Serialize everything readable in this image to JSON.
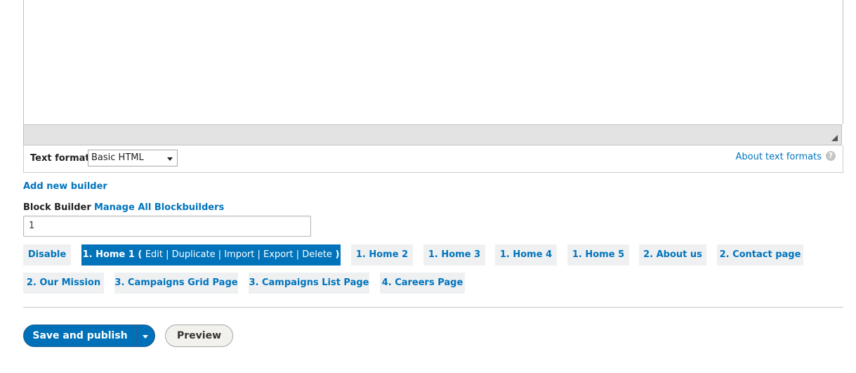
{
  "editor": {
    "text_format_label": "Text format",
    "text_format_value": "Basic HTML",
    "about_link": "About text formats",
    "help_icon": "?"
  },
  "builder": {
    "add_new_link": "Add new builder",
    "block_builder_label": "Block Builder",
    "manage_link": "Manage All Blockbuilders",
    "input_value": "1"
  },
  "tabs": [
    {
      "label": "Disable"
    },
    {
      "label": "1. Home 1 (",
      "actions": "Edit | Duplicate | Import | Export | Delete",
      "close": ")",
      "active": true
    },
    {
      "label": "1. Home 2"
    },
    {
      "label": "1. Home 3"
    },
    {
      "label": "1. Home 4"
    },
    {
      "label": "1. Home 5"
    },
    {
      "label": "2. About us"
    },
    {
      "label": "2. Contact page"
    },
    {
      "label": "2. Our Mission"
    },
    {
      "label": "3. Campaigns Grid Page"
    },
    {
      "label": "3. Campaigns List Page"
    },
    {
      "label": "4. Careers Page"
    }
  ],
  "actions": {
    "save_label": "Save and publish",
    "preview_label": "Preview"
  },
  "colors": {
    "accent": "#0074bd",
    "active_tab": "#0073bb"
  }
}
